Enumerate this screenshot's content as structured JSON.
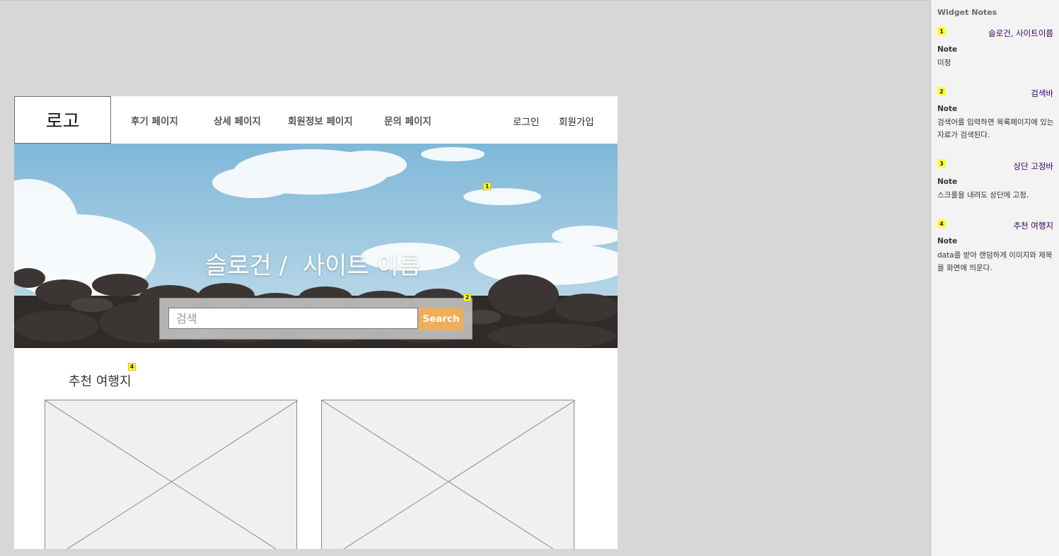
{
  "header": {
    "logo": "로고",
    "nav": [
      "후기 페이지",
      "상세 페이지",
      "회원정보 페이지",
      "문의 페이지"
    ],
    "login": "로그인",
    "signup": "회원가입"
  },
  "hero": {
    "slogan": "슬로건 /  사이트 이름",
    "search_placeholder": "검색",
    "search_button": "Search"
  },
  "recommend": {
    "title": "추천 여행지"
  },
  "badges": [
    "1",
    "2",
    "4"
  ],
  "notes_panel": {
    "header": "Widget Notes",
    "notes": [
      {
        "num": "1",
        "title": "슬로건, 사이트이름",
        "label": "Note",
        "text": "미정"
      },
      {
        "num": "2",
        "title": "검색바",
        "label": "Note",
        "text": "검색어를 입력하면 목록페이지에 있는 자료가 검색된다."
      },
      {
        "num": "3",
        "title": "상단 고정바",
        "label": "Note",
        "text": "스크롤을 내려도 상단에 고정."
      },
      {
        "num": "4",
        "title": "추천 여행지",
        "label": "Note",
        "text": "data를 받아 랜덤하게 이미지와 제목을 화면에 띄운다."
      }
    ]
  },
  "colors": {
    "search_button": "#f0ad5a",
    "badge": "#ffff33",
    "note_title": "#330066"
  }
}
